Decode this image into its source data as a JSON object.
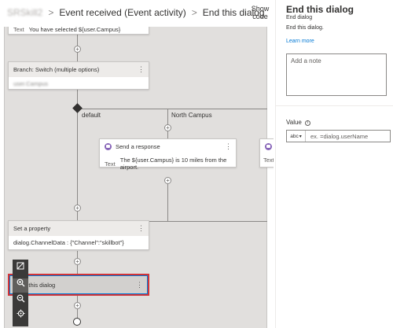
{
  "header": {
    "crumb_blurred": "SRSkill2",
    "crumb_trigger": "Event received (Event activity)",
    "crumb_current": "End this dialog",
    "separator": ">",
    "show_code": "Show code"
  },
  "canvas": {
    "top_text_prefix": "Text",
    "top_text_value": "You have selected ${user.Campus}",
    "switch_title": "Branch: Switch (multiple options)",
    "switch_condition": "user.Campus",
    "branch_default": "default",
    "branch_north": "North Campus",
    "send_title": "Send a response",
    "send_text_label": "Text",
    "send_text_value": "The ${user.Campus} is 10 miles from the airport.",
    "offscreen_text_label": "Text",
    "set_prop_title": "Set a property",
    "set_prop_value": "dialog.ChannelData : {\"Channel\":\"skillbot\"}",
    "end_dialog_label": "End this dialog",
    "plus": "+",
    "kebab": "⋮"
  },
  "zoom_toolbar": {
    "fit_icon": "fit-view-icon",
    "zoom_in_icon": "zoom-in-icon",
    "zoom_out_icon": "zoom-out-icon",
    "center_icon": "center-view-icon"
  },
  "panel": {
    "title": "End this dialog",
    "subtitle": "End dialog",
    "description": "End this dialog.",
    "learn_more": "Learn more",
    "note_placeholder": "Add a note",
    "value_label": "Value",
    "type_chip": "abc",
    "value_placeholder": "ex. =dialog.userName"
  },
  "colors": {
    "accent": "#0078d4",
    "selection_border": "#d13438",
    "send_icon": "#8764b8",
    "canvas_bg": "#e1dfdd"
  }
}
